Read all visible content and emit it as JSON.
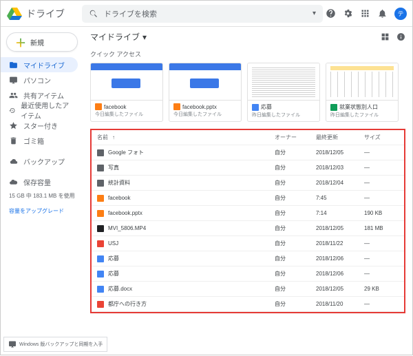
{
  "app": {
    "name": "ドライブ"
  },
  "search": {
    "placeholder": "ドライブを検索"
  },
  "avatar_letter": "テ",
  "new_button": "新規",
  "nav": [
    {
      "id": "mydrive",
      "label": "マイドライブ",
      "active": true
    },
    {
      "id": "computers",
      "label": "パソコン"
    },
    {
      "id": "shared",
      "label": "共有アイテム"
    },
    {
      "id": "recent",
      "label": "最近使用したアイテム"
    },
    {
      "id": "starred",
      "label": "スター付き"
    },
    {
      "id": "trash",
      "label": "ゴミ箱"
    }
  ],
  "nav2": [
    {
      "id": "backups",
      "label": "バックアップ"
    }
  ],
  "storage": {
    "line": "15 GB 中 183.1 MB を使用",
    "link": "容量をアップグレード",
    "nav_label": "保存容量"
  },
  "breadcrumb": "マイドライブ",
  "quick_access_label": "クイック アクセス",
  "quick_access": [
    {
      "name": "facebook",
      "sub": "今日編集したファイル",
      "thumb": "blue",
      "ico": "ico-pp"
    },
    {
      "name": "facebook.pptx",
      "sub": "今日編集したファイル",
      "thumb": "blue",
      "ico": "ico-pp"
    },
    {
      "name": "応募",
      "sub": "昨日編集したファイル",
      "thumb": "doc",
      "ico": "ico-doc"
    },
    {
      "name": "就業状態別人口",
      "sub": "昨日編集したファイル",
      "thumb": "sheet",
      "ico": "ico-sh"
    }
  ],
  "columns": {
    "name": "名前",
    "owner": "オーナー",
    "modified": "最終更新",
    "size": "サイズ"
  },
  "rows": [
    {
      "ico": "ico-fold",
      "name": "Google フォト",
      "owner": "自分",
      "modified": "2018/12/05",
      "size": "—"
    },
    {
      "ico": "ico-fold",
      "name": "写真",
      "owner": "自分",
      "modified": "2018/12/03",
      "size": "—"
    },
    {
      "ico": "ico-fold",
      "name": "統計資料",
      "owner": "自分",
      "modified": "2018/12/04",
      "size": "—"
    },
    {
      "ico": "ico-pp",
      "name": "facebook",
      "owner": "自分",
      "modified": "7:45",
      "size": "—"
    },
    {
      "ico": "ico-pp",
      "name": "facebook.pptx",
      "owner": "自分",
      "modified": "7:14",
      "size": "190 KB"
    },
    {
      "ico": "ico-vid",
      "name": "MVI_5806.MP4",
      "owner": "自分",
      "modified": "2018/12/05",
      "size": "181 MB"
    },
    {
      "ico": "ico-map",
      "name": "USJ",
      "owner": "自分",
      "modified": "2018/11/22",
      "size": "—"
    },
    {
      "ico": "ico-doc",
      "name": "応募",
      "owner": "自分",
      "modified": "2018/12/06",
      "size": "—"
    },
    {
      "ico": "ico-doc",
      "name": "応募",
      "owner": "自分",
      "modified": "2018/12/06",
      "size": "—"
    },
    {
      "ico": "ico-doc",
      "name": "応募.docx",
      "owner": "自分",
      "modified": "2018/12/05",
      "size": "29 KB"
    },
    {
      "ico": "ico-map",
      "name": "都庁への行き方",
      "owner": "自分",
      "modified": "2018/11/20",
      "size": "—"
    }
  ],
  "backup_sync": "Windows 版バックアップと同期を入手"
}
